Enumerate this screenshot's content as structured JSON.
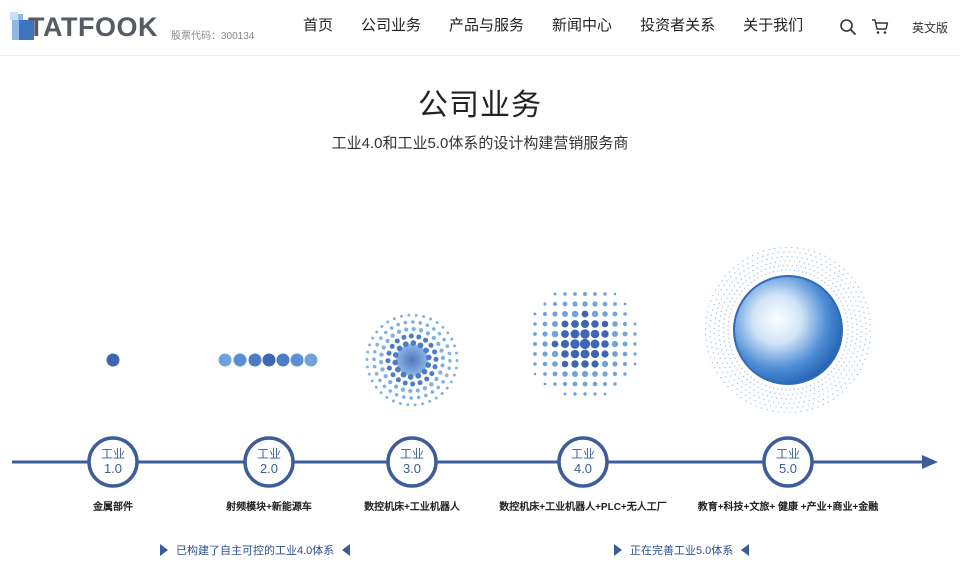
{
  "header": {
    "brand": "TATFOOK",
    "stock_label": "股票代码：",
    "stock_code": "300134",
    "nav": [
      "首页",
      "公司业务",
      "产品与服务",
      "新闻中心",
      "投资者关系",
      "关于我们"
    ],
    "icons": [
      "search-icon",
      "cart-icon"
    ],
    "lang_label": "英文版"
  },
  "hero": {
    "title": "公司业务",
    "subtitle": "工业4.0和工业5.0体系的设计构建营销服务商"
  },
  "timeline": {
    "stages": [
      {
        "word": "工业",
        "version": "1.0",
        "label": "金属部件"
      },
      {
        "word": "工业",
        "version": "2.0",
        "label": "射频模块+新能源车"
      },
      {
        "word": "工业",
        "version": "3.0",
        "label": "数控机床+工业机器人"
      },
      {
        "word": "工业",
        "version": "4.0",
        "label": "数控机床+工业机器人+PLC+无人工厂"
      },
      {
        "word": "工业",
        "version": "5.0",
        "label": "教育+科技+文旅+ 健康 +产业+商业+金融"
      }
    ],
    "notes": [
      {
        "text": "已构建了自主可控的工业4.0体系"
      },
      {
        "text": "正在完善工业5.0体系"
      }
    ]
  },
  "colors": {
    "accent": "#3b5c99",
    "accent_light": "#5b8fd6",
    "line": "#3d5d9a"
  }
}
